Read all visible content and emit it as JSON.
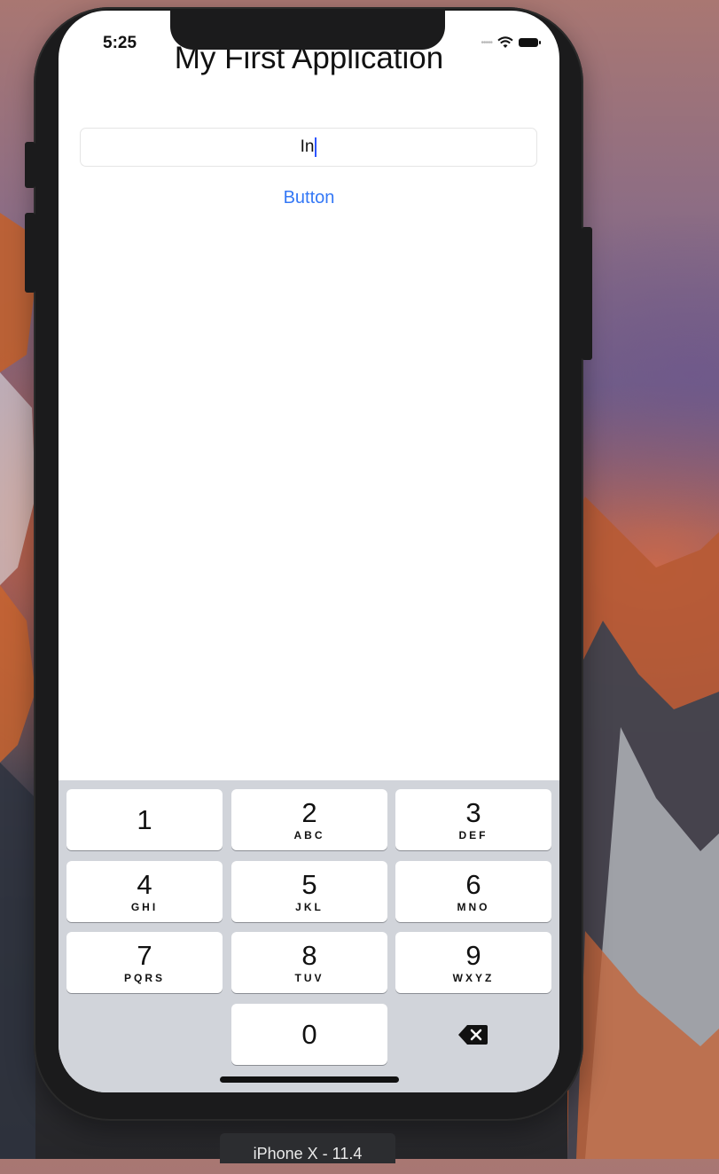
{
  "status_bar": {
    "time": "5:25"
  },
  "app": {
    "title": "My First Application",
    "text_field_value": "In",
    "button_label": "Button",
    "accent_color": "#3478f6"
  },
  "keypad": {
    "keys": [
      {
        "digit": "1",
        "letters": ""
      },
      {
        "digit": "2",
        "letters": "ABC"
      },
      {
        "digit": "3",
        "letters": "DEF"
      },
      {
        "digit": "4",
        "letters": "GHI"
      },
      {
        "digit": "5",
        "letters": "JKL"
      },
      {
        "digit": "6",
        "letters": "MNO"
      },
      {
        "digit": "7",
        "letters": "PQRS"
      },
      {
        "digit": "8",
        "letters": "TUV"
      },
      {
        "digit": "9",
        "letters": "WXYZ"
      },
      {
        "digit": "0",
        "letters": ""
      }
    ],
    "delete_icon": "delete-backspace-icon"
  },
  "simulator": {
    "device_label": "iPhone X - 11.4"
  }
}
